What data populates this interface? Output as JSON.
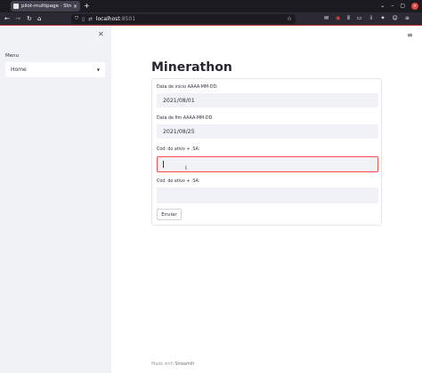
{
  "browser": {
    "tab_title": "pilot-multipage · Stre...",
    "url_host": "localhost",
    "url_port": ":8501"
  },
  "sidebar": {
    "menu_label": "Menu",
    "select_value": "Home"
  },
  "main": {
    "title": "Minerathon",
    "fields": [
      {
        "label": "Data de início AAAA-MM-DD:",
        "value": ""
      },
      {
        "label": "Data de fim AAAA-MM-DD",
        "value": ""
      },
      {
        "label": "Cód. do ativo + .SA:",
        "value": ""
      },
      {
        "label": "Cód. do ativo + .SA:",
        "value": ""
      }
    ],
    "start_date": "2021/08/01",
    "end_date": "2021/08/25",
    "submit_label": "Enviar"
  },
  "footer": {
    "prefix": "Made with ",
    "link": "Streamlit"
  },
  "colors": {
    "accent": "#ff4b4b",
    "sidebar_bg": "#f0f2f6"
  }
}
